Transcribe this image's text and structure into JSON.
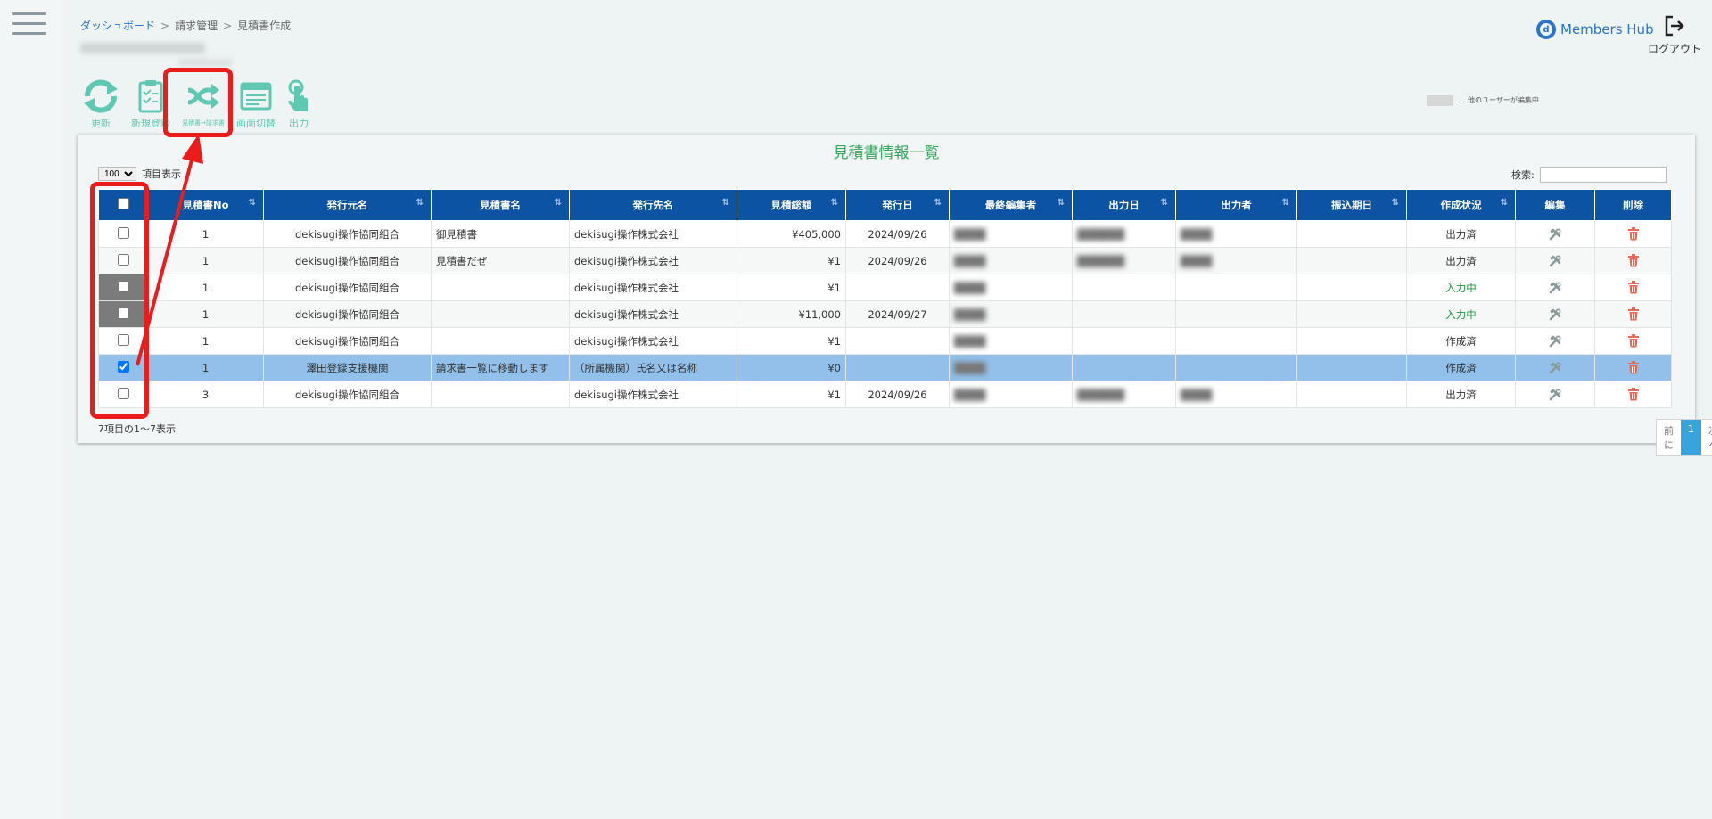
{
  "breadcrumb": {
    "home": "ダッシュボード",
    "level2": "請求管理",
    "current": "見積書作成"
  },
  "brand": {
    "name": "Members Hub",
    "logo_letter": "d"
  },
  "header": {
    "logout_label": "ログアウト"
  },
  "toolbar": {
    "refresh_label": "更新",
    "new_label": "新規登録",
    "convert_label": "見積書→請求書",
    "switch_label": "画面切替",
    "output_label": "出力"
  },
  "legend": {
    "text": "…他のユーザーが編集中"
  },
  "panel": {
    "title": "見積書情報一覧"
  },
  "list": {
    "per_page": "100",
    "per_page_suffix": "項目表示",
    "search_label": "検索:",
    "search_value": "",
    "result_text": "7項目の1〜7表示"
  },
  "pager": {
    "prev": "前に",
    "page": "1",
    "next": "次へ"
  },
  "columns": [
    "見積書No",
    "発行元名",
    "見積書名",
    "発行先名",
    "見積総額",
    "発行日",
    "最終編集者",
    "出力日",
    "出力者",
    "振込期日",
    "作成状況",
    "編集",
    "削除"
  ],
  "rows": [
    {
      "no": "1",
      "issuer": "dekisugi操作協同組合",
      "title": "御見積書",
      "recipient": "dekisugi操作株式会社",
      "amount": "¥405,000",
      "date": "2024/09/26",
      "status": "出力済",
      "checked": false,
      "selected": false,
      "dark": false,
      "green": false
    },
    {
      "no": "1",
      "issuer": "dekisugi操作協同組合",
      "title": "見積書だぜ",
      "recipient": "dekisugi操作株式会社",
      "amount": "¥1",
      "date": "2024/09/26",
      "status": "出力済",
      "checked": false,
      "selected": false,
      "dark": false,
      "green": false
    },
    {
      "no": "1",
      "issuer": "dekisugi操作協同組合",
      "title": "",
      "recipient": "dekisugi操作株式会社",
      "amount": "¥1",
      "date": "",
      "status": "入力中",
      "checked": false,
      "selected": false,
      "dark": true,
      "green": true
    },
    {
      "no": "1",
      "issuer": "dekisugi操作協同組合",
      "title": "",
      "recipient": "dekisugi操作株式会社",
      "amount": "¥11,000",
      "date": "2024/09/27",
      "status": "入力中",
      "checked": false,
      "selected": false,
      "dark": true,
      "green": true
    },
    {
      "no": "1",
      "issuer": "dekisugi操作協同組合",
      "title": "",
      "recipient": "dekisugi操作株式会社",
      "amount": "¥1",
      "date": "",
      "status": "作成済",
      "checked": false,
      "selected": false,
      "dark": false,
      "green": false
    },
    {
      "no": "1",
      "issuer": "澤田登録支援機関",
      "title": "請求書一覧に移動します",
      "recipient": "（所属機関）氏名又は名称",
      "amount": "¥0",
      "date": "",
      "status": "作成済",
      "checked": true,
      "selected": true,
      "dark": false,
      "green": false
    },
    {
      "no": "3",
      "issuer": "dekisugi操作協同組合",
      "title": "",
      "recipient": "dekisugi操作株式会社",
      "amount": "¥1",
      "date": "2024/09/26",
      "status": "出力済",
      "checked": false,
      "selected": false,
      "dark": false,
      "green": false
    }
  ],
  "colors": {
    "header": "#0d53a3",
    "accent_teal": "#5fc8b2",
    "selected_row": "#92c0ea",
    "annotation": "#ea1c1c",
    "title_green": "#33a85a"
  }
}
